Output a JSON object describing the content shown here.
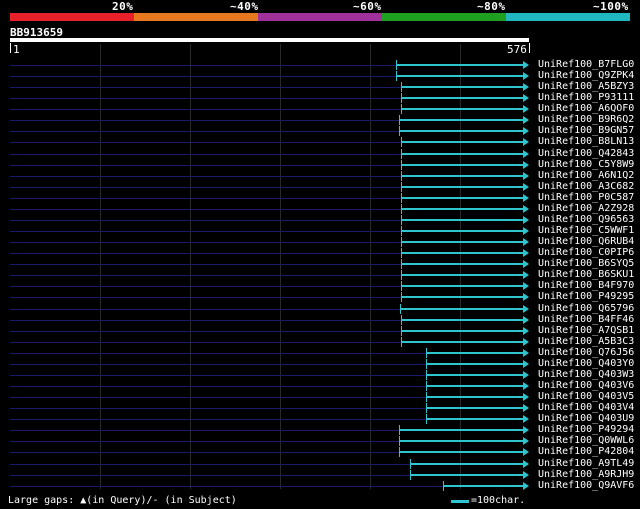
{
  "header": {
    "percent_labels": [
      "20%",
      "~40%",
      "~60%",
      "~80%",
      "~100%"
    ],
    "band_colors": [
      "#e8202a",
      "#e87820",
      "#a0309a",
      "#20a020",
      "#20b8c0"
    ]
  },
  "query": {
    "id": "BB913659",
    "start": "1",
    "end": "576",
    "length": 576
  },
  "hits": [
    {
      "name": "UniRef100_B7FLG0",
      "start": 428
    },
    {
      "name": "UniRef100_Q9ZPK4",
      "start": 428
    },
    {
      "name": "UniRef100_A5BZY3",
      "start": 434
    },
    {
      "name": "UniRef100_P93111",
      "start": 434
    },
    {
      "name": "UniRef100_A6QOF0",
      "start": 434
    },
    {
      "name": "UniRef100_B9R6Q2",
      "start": 432
    },
    {
      "name": "UniRef100_B9GN57",
      "start": 432
    },
    {
      "name": "UniRef100_B8LN13",
      "start": 434
    },
    {
      "name": "UniRef100_Q42843",
      "start": 434
    },
    {
      "name": "UniRef100_C5Y8W9",
      "start": 434
    },
    {
      "name": "UniRef100_A6N1Q2",
      "start": 434
    },
    {
      "name": "UniRef100_A3C682",
      "start": 434
    },
    {
      "name": "UniRef100_P0C587",
      "start": 434
    },
    {
      "name": "UniRef100_A2Z928",
      "start": 434
    },
    {
      "name": "UniRef100_Q96563",
      "start": 434
    },
    {
      "name": "UniRef100_C5WWF1",
      "start": 434
    },
    {
      "name": "UniRef100_Q6RUB4",
      "start": 434
    },
    {
      "name": "UniRef100_C0PIP6",
      "start": 434
    },
    {
      "name": "UniRef100_B6SYQ5",
      "start": 434
    },
    {
      "name": "UniRef100_B6SKU1",
      "start": 434
    },
    {
      "name": "UniRef100_B4F970",
      "start": 434
    },
    {
      "name": "UniRef100_P49295",
      "start": 434
    },
    {
      "name": "UniRef100_Q65796",
      "start": 433
    },
    {
      "name": "UniRef100_B4FF46",
      "start": 434
    },
    {
      "name": "UniRef100_A7QSB1",
      "start": 434
    },
    {
      "name": "UniRef100_A5B3C3",
      "start": 434
    },
    {
      "name": "UniRef100_Q76J56",
      "start": 462
    },
    {
      "name": "UniRef100_Q403Y0",
      "start": 462
    },
    {
      "name": "UniRef100_Q403W3",
      "start": 462
    },
    {
      "name": "UniRef100_Q403V6",
      "start": 462
    },
    {
      "name": "UniRef100_Q403V5",
      "start": 462
    },
    {
      "name": "UniRef100_Q403V4",
      "start": 462
    },
    {
      "name": "UniRef100_Q403U9",
      "start": 462
    },
    {
      "name": "UniRef100_P49294",
      "start": 432
    },
    {
      "name": "UniRef100_Q0WWL6",
      "start": 432
    },
    {
      "name": "UniRef100_P42804",
      "start": 432
    },
    {
      "name": "UniRef100_A9TL49",
      "start": 444
    },
    {
      "name": "UniRef100_A9RJH9",
      "start": 444
    },
    {
      "name": "UniRef100_Q9AVF6",
      "start": 481
    }
  ],
  "footer": {
    "gaps_text": "Large gaps: ▲(in Query)/- (in Subject)",
    "legend_text": "=100char."
  },
  "colors": {
    "hit": "#2ec5cf",
    "row_background": "#1a1a6a"
  }
}
